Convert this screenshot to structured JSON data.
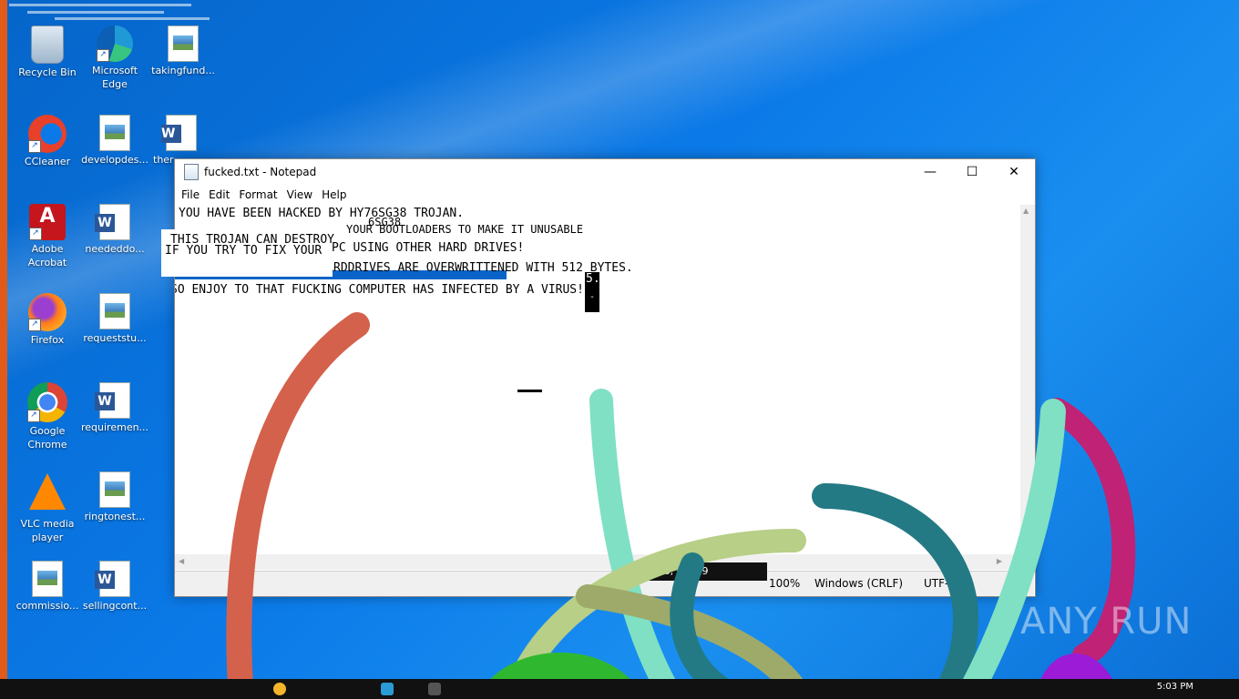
{
  "desktop": {
    "icons": [
      {
        "label": "Recycle Bin",
        "icon": "recycle-bin-icon"
      },
      {
        "label": "Microsoft Edge",
        "icon": "edge-icon"
      },
      {
        "label": "takingfund...",
        "icon": "image-file-icon"
      },
      {
        "label": "CCleaner",
        "icon": "ccleaner-icon"
      },
      {
        "label": "developdes...",
        "icon": "image-file-icon"
      },
      {
        "label": "ther",
        "icon": "word-file-icon"
      },
      {
        "label": "Adobe Acrobat",
        "icon": "acrobat-icon"
      },
      {
        "label": "neededdo...",
        "icon": "word-file-icon"
      },
      {
        "label": "Firefox",
        "icon": "firefox-icon"
      },
      {
        "label": "requeststu...",
        "icon": "image-file-icon"
      },
      {
        "label": "Google Chrome",
        "icon": "chrome-icon"
      },
      {
        "label": "requiremen...",
        "icon": "word-file-icon"
      },
      {
        "label": "VLC media player",
        "icon": "vlc-icon"
      },
      {
        "label": "ringtonest...",
        "icon": "image-file-icon"
      },
      {
        "label": "commissio...",
        "icon": "image-file-icon"
      },
      {
        "label": "sellingcont...",
        "icon": "word-file-icon"
      }
    ]
  },
  "notepad": {
    "title": "fucked.txt - Notepad",
    "menu": [
      "File",
      "Edit",
      "Format",
      "View",
      "Help"
    ],
    "window_buttons": {
      "minimize": "—",
      "maximize": "☐",
      "close": "✕"
    },
    "lines": [
      "YOU HAVE BEEN HACKED BY HY76SG38 TROJAN.",
      "6SG38",
      "YOUR BOOTLOADERS TO MAKE IT UNUSABLE",
      "THIS TROJAN CAN DESTROY",
      "IF YOU TRY TO FIX YOUR",
      "PC USING OTHER HARD DRIVES!",
      "YOU CANT BECAUSE THE HARDDRIVES ARE OVERWRITTENED WITH 512 BYTES.",
      "SO ENJOY TO THAT FUCKING COMPUTER HAS INFECTED BY A VIRUS!",
      "5.",
      "-"
    ],
    "status": {
      "position": "Ln 6, Col 59",
      "zoom": "100%",
      "line_ending": "Windows (CRLF)",
      "encoding": "UTF-8"
    },
    "tooltip": "Ln 6, Col 59"
  },
  "watermark": "ANY RUN",
  "taskbar": {
    "clock_time": "5:03 PM",
    "accent": "#111111"
  },
  "colors": {
    "desktop_blue": "#0a6fd8",
    "selection_blue": "#0a64c8",
    "curve_red": "#d4614b",
    "curve_mint": "#7fe0c4",
    "curve_teal": "#237a84",
    "curve_olive": "#b7cf86",
    "curve_magenta": "#c02275",
    "curve_green": "#2fb82f",
    "curve_purple": "#9b1bd6"
  }
}
